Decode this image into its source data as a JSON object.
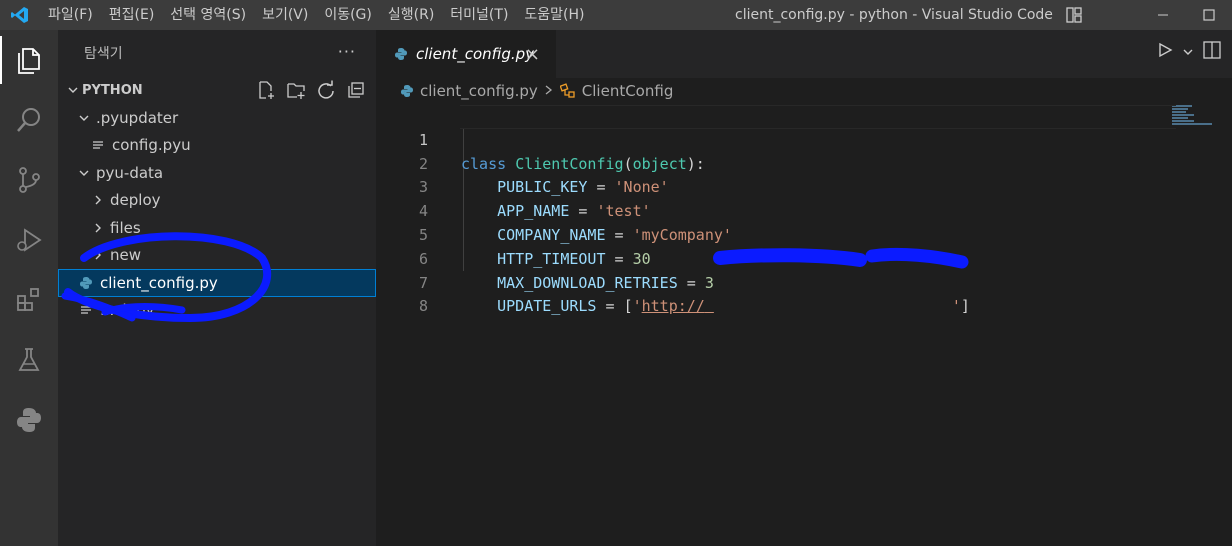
{
  "titlebar": {
    "menu": [
      "파일(F)",
      "편집(E)",
      "선택 영역(S)",
      "보기(V)",
      "이동(G)",
      "실행(R)",
      "터미널(T)",
      "도움말(H)"
    ],
    "window_title": "client_config.py - python - Visual Studio Code"
  },
  "activitybar": {
    "icons": [
      "explorer-icon",
      "search-icon",
      "source-control-icon",
      "run-debug-icon",
      "extensions-icon",
      "testing-icon",
      "python-icon"
    ]
  },
  "sidebar": {
    "title": "탐색기",
    "more": "···",
    "section": "PYTHON",
    "tree": [
      {
        "label": ".pyupdater",
        "type": "folder",
        "expanded": true,
        "depth": 1
      },
      {
        "label": "config.pyu",
        "type": "file",
        "depth": 2
      },
      {
        "label": "pyu-data",
        "type": "folder",
        "expanded": true,
        "depth": 1
      },
      {
        "label": "deploy",
        "type": "folder",
        "expanded": false,
        "depth": 2
      },
      {
        "label": "files",
        "type": "folder",
        "expanded": false,
        "depth": 2
      },
      {
        "label": "new",
        "type": "folder",
        "expanded": false,
        "depth": 2
      },
      {
        "label": "client_config.py",
        "type": "python",
        "depth": 1,
        "selected": true
      },
      {
        "label": "...ck.py",
        "type": "file",
        "depth": 1
      }
    ]
  },
  "editor": {
    "tab_label": "client_config.py",
    "breadcrumb": {
      "file": "client_config.py",
      "symbol": "ClientConfig"
    },
    "lines": [
      "1",
      "2",
      "3",
      "4",
      "5",
      "6",
      "7",
      "8"
    ],
    "code": {
      "l1_kw": "class",
      "l1_cls": "ClientConfig",
      "l1_paren_open": "(",
      "l1_base": "object",
      "l1_paren_close": "):",
      "l2_var": "PUBLIC_KEY",
      "l2_val": "'None'",
      "l3_var": "APP_NAME",
      "l3_val": "'test'",
      "l4_var": "COMPANY_NAME",
      "l4_val": "'myCompany'",
      "l5_var": "HTTP_TIMEOUT",
      "l5_val": "30",
      "l6_var": "MAX_DOWNLOAD_RETRIES",
      "l6_val": "3",
      "l7_var": "UPDATE_URLS",
      "l7_val_prefix": "'",
      "l7_url": "http://",
      "l7_val_suffix": "'",
      "eq": " = ",
      "bracket_open": "[",
      "bracket_close": "]"
    }
  },
  "colors": {
    "titlebar": "#3c3c3c",
    "activitybar": "#333333",
    "sidebar": "#252526",
    "editor": "#1e1e1e",
    "selection": "#04395e",
    "scribble": "#0b1bff"
  }
}
